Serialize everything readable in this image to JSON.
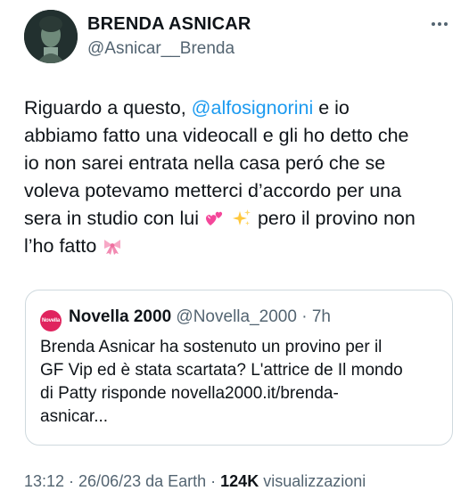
{
  "author": {
    "name": "BRENDA ASNICAR",
    "handle": "@Asnicar__Brenda"
  },
  "tweet": {
    "text_before_mention": "Riguardo a questo, ",
    "mention": "@alfosignorini",
    "text_after_mention": " e io\nabbiamo fatto una videocall e gli ho detto che\nio non sarei entrata nella casa peró che se\nvoleva potevamo metterci d’accordo per una\nsera in studio con lui ",
    "text_after_emojis": " pero il provino non\nl’ho fatto ",
    "emojis": [
      "two-hearts",
      "sparkles",
      "ribbon"
    ]
  },
  "quote": {
    "logo_text": "Novella",
    "name": "Novella 2000",
    "handle": "@Novella_2000",
    "separator": " · ",
    "time": "7h",
    "text": "Brenda Asnicar ha sostenuto un provino per il\nGF Vip ed è stata scartata? L'attrice de Il mondo\ndi Patty risponde novella2000.it/brenda-\nasnicar..."
  },
  "footer": {
    "timestamp": "13:12 · 26/06/23 da Earth · ",
    "views_count": "124K",
    "views_label": " visualizzazioni"
  },
  "colors": {
    "accent": "#1d9bf0",
    "muted": "#536471",
    "novella_brand": "#e0245e"
  }
}
